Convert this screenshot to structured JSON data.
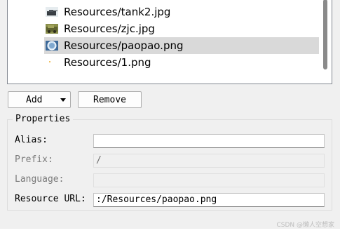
{
  "files": [
    {
      "name": "Resources/tank2.jpg",
      "icon": "tank-thumbnail-icon",
      "selected": false
    },
    {
      "name": "Resources/zjc.jpg",
      "icon": "vehicle-thumbnail-icon",
      "selected": false
    },
    {
      "name": "Resources/paopao.png",
      "icon": "bubble-thumbnail-icon",
      "selected": true
    },
    {
      "name": "Resources/1.png",
      "icon": "small-image-icon",
      "selected": false
    }
  ],
  "buttons": {
    "add": "Add",
    "remove": "Remove"
  },
  "properties": {
    "title": "Properties",
    "alias_label": "Alias:",
    "alias_value": "",
    "prefix_label": "Prefix:",
    "prefix_value": "/",
    "language_label": "Language:",
    "language_value": "",
    "url_label": "Resource URL:",
    "url_value": ":/Resources/paopao.png"
  },
  "watermark": "CSDN @懒人空想家",
  "colors": {
    "selection": "#d9d9d9",
    "scrollbar": "#8a8a8a"
  }
}
